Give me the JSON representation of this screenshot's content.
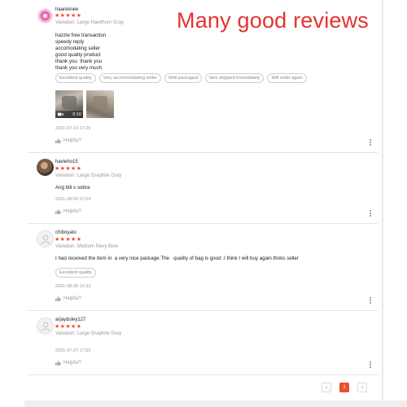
{
  "overlay_title": "Many good reviews",
  "colors": {
    "accent": "#ee4d2d",
    "overlay_title": "#e5322d"
  },
  "reviews": [
    {
      "username": "haareknee",
      "stars": "★★★★★",
      "rating": 5,
      "variation": "Variation: Large Hawthorn Gray",
      "text": "hazzle free transaction\nspeedy reply\naccomodating seller\ngood quality product\nthank you  thank you\nthank you very much",
      "tags": [
        "Excellent quality",
        "Very accommodating seller",
        "Well-packaged",
        "Item shipped immediately",
        "Will order again"
      ],
      "video_duration": "0:10",
      "date": "2021-07-19 17:29",
      "helpful": "Helpful?"
    },
    {
      "username": "havieho15",
      "stars": "★★★★★",
      "rating": 5,
      "variation": "Variation: Large Graphite Gray",
      "text": "Ang bili s sobra",
      "date": "2021-08-06 07:04",
      "helpful": "Helpful?"
    },
    {
      "username": "chiboyato",
      "stars": "★★★★★",
      "rating": 5,
      "variation": "Variation: Medium Navy Blue",
      "text": "I had received the item in  a very nice package.The   quality of bag is good .I think I will buy again.thnks seller",
      "tags": [
        "Excellent quality"
      ],
      "date": "2021-08-08 15:33",
      "helpful": "Helpful?"
    },
    {
      "username": "arjayduley127",
      "stars": "★★★★★",
      "rating": 5,
      "variation": "Variation: Large Graphite Gray",
      "date": "2021-07-27 17:56",
      "helpful": "Helpful?"
    }
  ],
  "pagination": {
    "prev": "‹",
    "current": "1",
    "next": "›"
  }
}
